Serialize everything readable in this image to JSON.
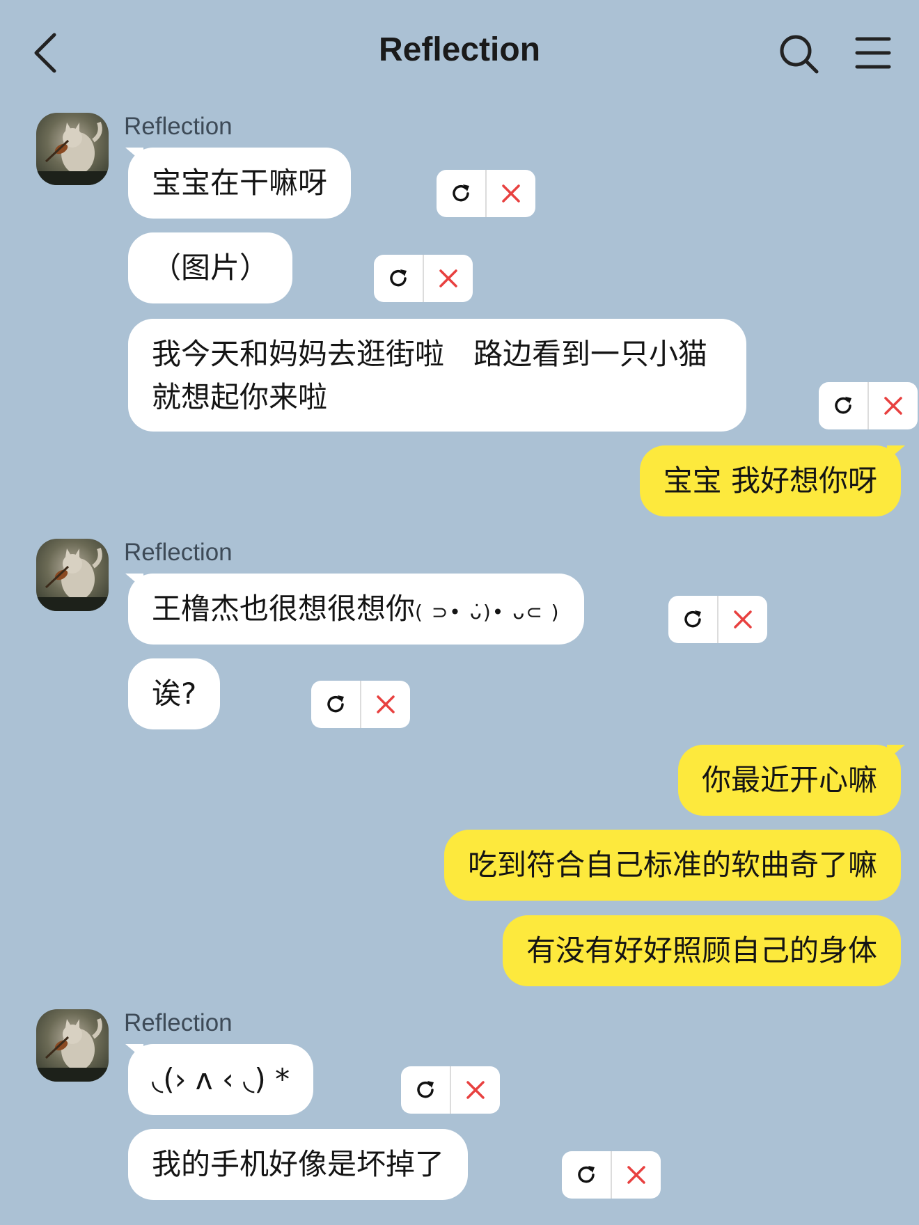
{
  "header": {
    "title": "Reflection"
  },
  "colors": {
    "background": "#abc1d4",
    "incoming_bubble": "#ffffff",
    "outgoing_bubble": "#fde93d",
    "delete_icon": "#e8403f"
  },
  "icons": {
    "back": "chevron-left-icon",
    "search": "search-icon",
    "menu": "hamburger-menu-icon",
    "regenerate": "refresh-icon",
    "delete": "close-icon"
  },
  "messages": {
    "group1": {
      "sender": "Reflection",
      "m1": "宝宝在干嘛呀",
      "m2": "（图片）",
      "m3": "我今天和妈妈去逛街啦　路边看到一只小猫 就想起你来啦"
    },
    "out1": "宝宝 我好想你呀",
    "group2": {
      "sender": "Reflection",
      "m1_text": "王橹杰也很想很想你",
      "m1_kaomoji": "( ⊃• ᴗ̇)• ᴗ⊂ )",
      "m2": "诶?"
    },
    "out2": "你最近开心嘛",
    "out3": "吃到符合自己标准的软曲奇了嘛",
    "out4": "有没有好好照顾自己的身体",
    "group3": {
      "sender": "Reflection",
      "m1": "◟(› ᴧ ‹ ◟) *",
      "m2": "我的手机好像是坏掉了"
    }
  }
}
